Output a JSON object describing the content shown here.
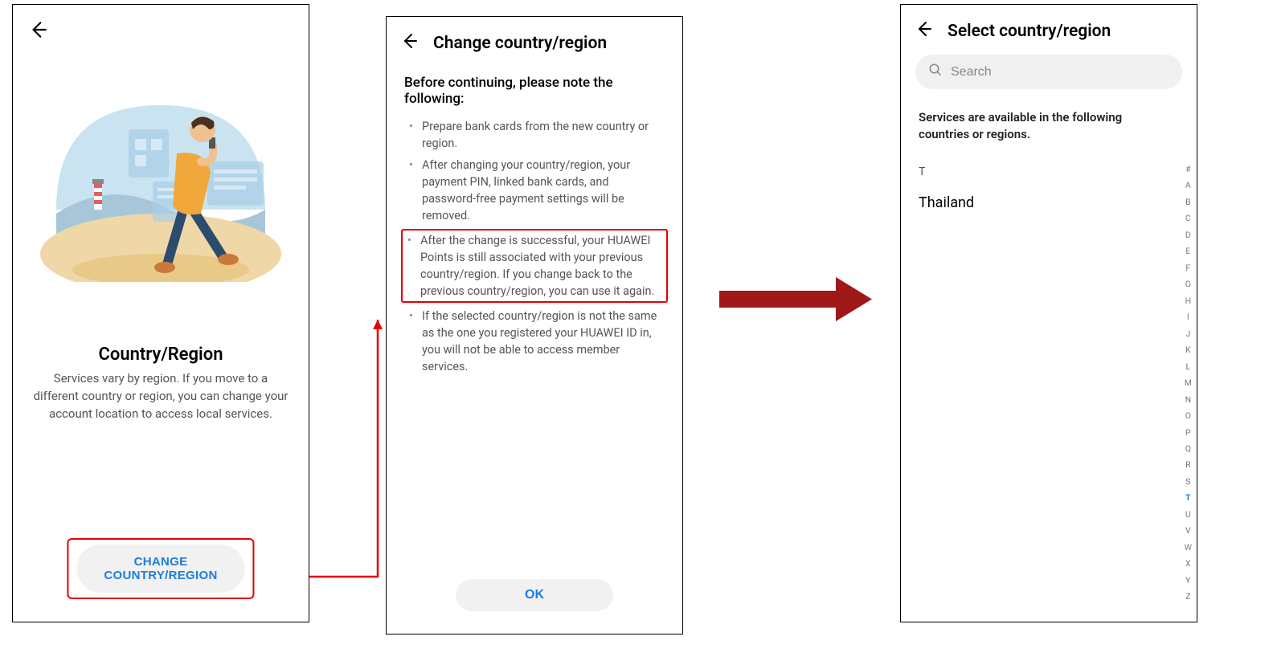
{
  "screen1": {
    "title": "Country/Region",
    "desc": "Services vary by region. If you move to a different country or region, you can change your account location to access local services.",
    "button_label": "CHANGE COUNTRY/REGION"
  },
  "screen2": {
    "title": "Change country/region",
    "lead": "Before continuing, please note the following:",
    "items": [
      "Prepare bank cards from the new country or region.",
      "After changing your country/region, your payment PIN, linked bank cards, and password-free payment settings will be removed.",
      "After the change is successful, your HUAWEI Points is still associated with your previous country/region. If you change back to the previous country/region, you can use it again.",
      "If the selected country/region is not the same as the one you registered your HUAWEI ID in, you will not be able to access member services."
    ],
    "ok_label": "OK"
  },
  "screen3": {
    "title": "Select country/region",
    "search_placeholder": "Search",
    "note": "Services are available in the following countries or regions.",
    "section_letter": "T",
    "country": "Thailand",
    "index_letters": [
      "#",
      "A",
      "B",
      "C",
      "D",
      "E",
      "F",
      "G",
      "H",
      "I",
      "J",
      "K",
      "L",
      "M",
      "N",
      "O",
      "P",
      "Q",
      "R",
      "S",
      "T",
      "U",
      "V",
      "W",
      "X",
      "Y",
      "Z"
    ],
    "active_letter": "T"
  }
}
